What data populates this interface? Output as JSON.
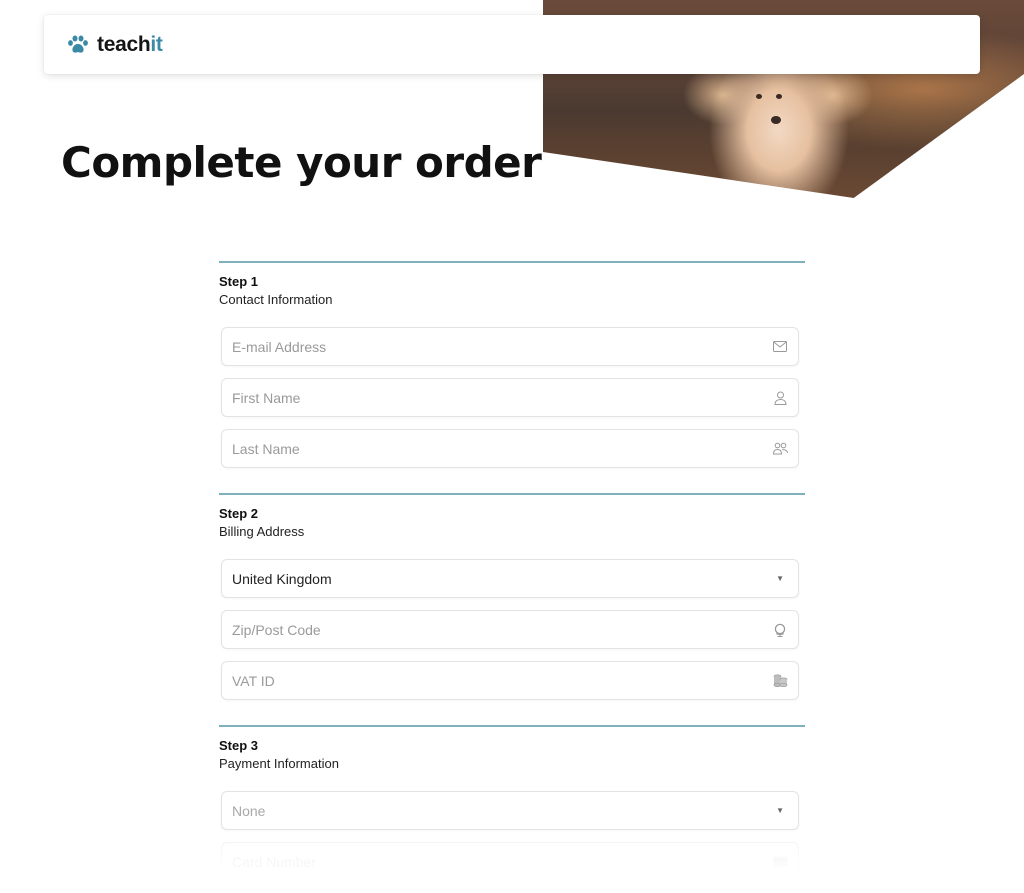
{
  "brand": {
    "name_main": "teach",
    "name_accent": "it",
    "accent_color": "#3a8aa6",
    "logo_icon": "paw-icon"
  },
  "hero": {
    "image_subject": "golden retriever puppy running"
  },
  "page": {
    "title": "Complete your order"
  },
  "steps": [
    {
      "number": "Step 1",
      "label": "Contact Information",
      "fields": [
        {
          "placeholder": "E-mail Address",
          "value": "",
          "icon": "mail-icon"
        },
        {
          "placeholder": "First Name",
          "value": "",
          "icon": "user-icon"
        },
        {
          "placeholder": "Last Name",
          "value": "",
          "icon": "users-icon"
        }
      ]
    },
    {
      "number": "Step 2",
      "label": "Billing Address",
      "fields": [
        {
          "type": "select",
          "value": "United Kingdom",
          "icon": "caret-down-icon"
        },
        {
          "placeholder": "Zip/Post Code",
          "value": "",
          "icon": "globe-icon"
        },
        {
          "placeholder": "VAT ID",
          "value": "",
          "icon": "coins-icon"
        }
      ]
    },
    {
      "number": "Step 3",
      "label": "Payment Information",
      "fields": [
        {
          "type": "select",
          "value": "None",
          "icon": "caret-down-icon"
        },
        {
          "placeholder": "Card Number",
          "value": "",
          "icon": "credit-card-icon"
        }
      ]
    }
  ],
  "colors": {
    "divider": "#7eb0bd",
    "title": "#111111",
    "placeholder": "#9a9a9a"
  }
}
